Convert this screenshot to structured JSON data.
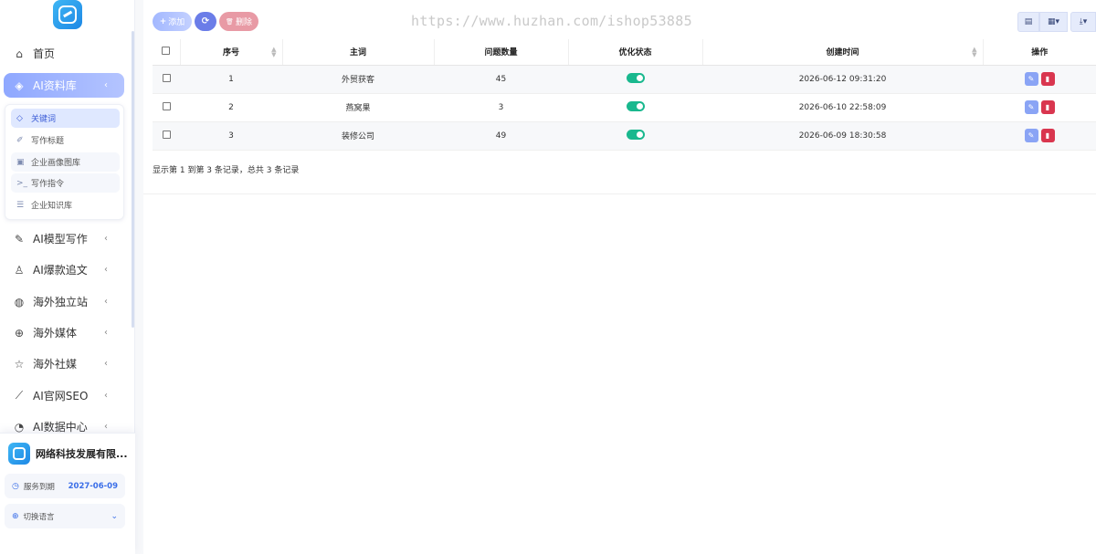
{
  "sidebar": {
    "items": [
      {
        "label": "首页",
        "icon": "home-icon",
        "glyph": "⌂"
      },
      {
        "label": "AI资料库",
        "icon": "layers-icon",
        "glyph": "◈",
        "chev": "‹"
      },
      {
        "label": "AI模型写作",
        "icon": "pen-icon",
        "glyph": "✎",
        "chev": "‹"
      },
      {
        "label": "AI爆款追文",
        "icon": "bell-icon",
        "glyph": "♙",
        "chev": "‹"
      },
      {
        "label": "海外独立站",
        "icon": "globe-icon",
        "glyph": "◍",
        "chev": "‹"
      },
      {
        "label": "海外媒体",
        "icon": "world-icon",
        "glyph": "⊕",
        "chev": "‹"
      },
      {
        "label": "海外社媒",
        "icon": "star-icon",
        "glyph": "☆",
        "chev": "‹"
      },
      {
        "label": "AI官网SEO",
        "icon": "chart-line-icon",
        "glyph": "⟋",
        "chev": "‹"
      },
      {
        "label": "AI数据中心",
        "icon": "pie-icon",
        "glyph": "◔",
        "chev": "‹"
      }
    ],
    "submenu": [
      {
        "label": "关键词",
        "icon": "tag-icon",
        "glyph": "◇"
      },
      {
        "label": "写作标题",
        "icon": "feather-icon",
        "glyph": "✐"
      },
      {
        "label": "企业画像图库",
        "icon": "image-icon",
        "glyph": "▣"
      },
      {
        "label": "写作指令",
        "icon": "terminal-icon",
        "glyph": ">_"
      },
      {
        "label": "企业知识库",
        "icon": "database-icon",
        "glyph": "☰"
      }
    ],
    "company": {
      "name": "网络科技发展有限...",
      "expiry_label": "服务到期",
      "expiry_value": "2027-06-09",
      "language_label": "切换语言"
    }
  },
  "toolbar": {
    "add_label": "添加",
    "add_icon": "+",
    "refresh_icon": "⟳",
    "delete_label": "删除",
    "delete_icon": "🗑"
  },
  "watermark": "https://www.huzhan.com/ishop53885",
  "table": {
    "columns": [
      "序号",
      "主词",
      "问题数量",
      "优化状态",
      "创建时间",
      "操作"
    ],
    "rows": [
      {
        "index": "1",
        "keyword": "外贸获客",
        "count": "45",
        "created": "2026-06-12 09:31:20"
      },
      {
        "index": "2",
        "keyword": "燕窝果",
        "count": "3",
        "created": "2026-06-10 22:58:09"
      },
      {
        "index": "3",
        "keyword": "装修公司",
        "count": "49",
        "created": "2026-06-09 18:30:58"
      }
    ],
    "summary": "显示第 1 到第 3 条记录，总共 3 条记录"
  }
}
